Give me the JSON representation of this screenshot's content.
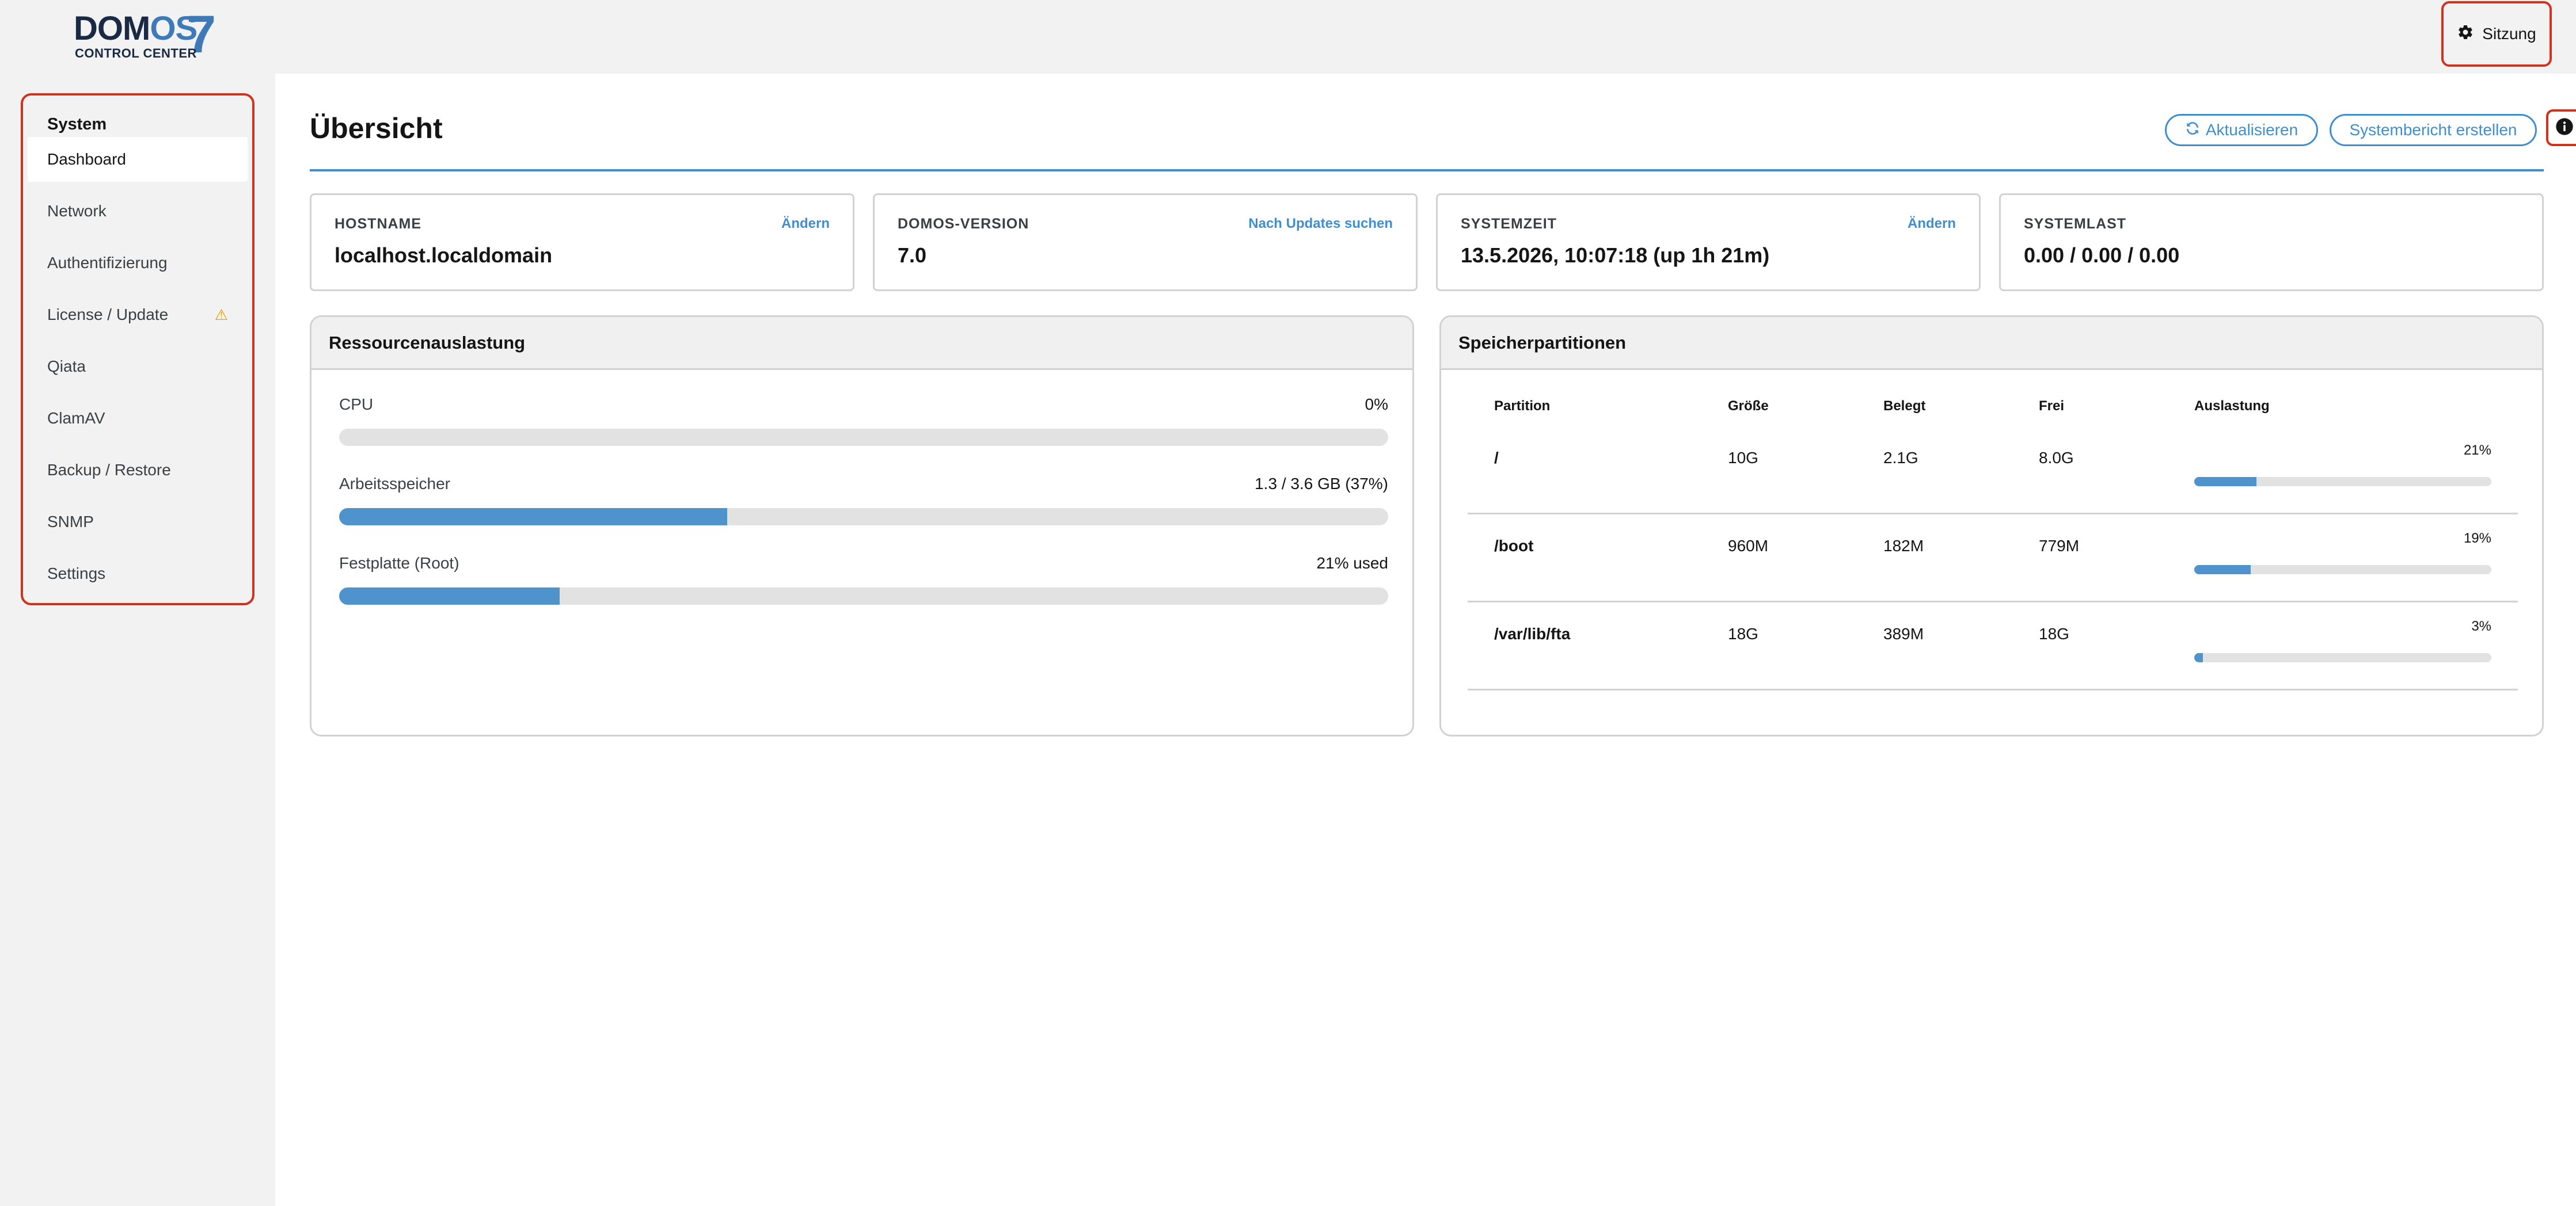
{
  "header": {
    "logo_main": "DOM",
    "logo_os": "OS",
    "logo_seven": "7",
    "logo_sub": "CONTROL CENTER",
    "session_label": "Sitzung"
  },
  "sidebar": {
    "heading": "System",
    "items": [
      {
        "label": "Dashboard",
        "active": true
      },
      {
        "label": "Network"
      },
      {
        "label": "Authentifizierung"
      },
      {
        "label": "License / Update",
        "warning": true
      },
      {
        "label": "Qiata"
      },
      {
        "label": "ClamAV"
      },
      {
        "label": "Backup / Restore"
      },
      {
        "label": "SNMP"
      },
      {
        "label": "Settings"
      }
    ]
  },
  "main": {
    "title": "Übersicht",
    "refresh_label": "Aktualisieren",
    "report_label": "Systembericht erstellen",
    "cards": [
      {
        "label": "HOSTNAME",
        "link": "Ändern",
        "value": "localhost.localdomain"
      },
      {
        "label": "DOMOS-VERSION",
        "link": "Nach Updates suchen",
        "value": "7.0"
      },
      {
        "label": "SYSTEMZEIT",
        "link": "Ändern",
        "value": "13.5.2026, 10:07:18 (up 1h 21m)"
      },
      {
        "label": "SYSTEMLAST",
        "link": "",
        "value": "0.00 / 0.00 / 0.00"
      }
    ],
    "resources": {
      "title": "Ressourcenauslastung",
      "items": [
        {
          "label": "CPU",
          "value": "0%",
          "percent": 0
        },
        {
          "label": "Arbeitsspeicher",
          "value": "1.3 / 3.6 GB (37%)",
          "percent": 37
        },
        {
          "label": "Festplatte (Root)",
          "value": "21% used",
          "percent": 21
        }
      ]
    },
    "partitions": {
      "title": "Speicherpartitionen",
      "headers": [
        "Partition",
        "Größe",
        "Belegt",
        "Frei",
        "Auslastung"
      ],
      "rows": [
        {
          "name": "/",
          "size": "10G",
          "used": "2.1G",
          "free": "8.0G",
          "usage": "21%",
          "percent": 21
        },
        {
          "name": "/boot",
          "size": "960M",
          "used": "182M",
          "free": "779M",
          "usage": "19%",
          "percent": 19
        },
        {
          "name": "/var/lib/fta",
          "size": "18G",
          "used": "389M",
          "free": "18G",
          "usage": "3%",
          "percent": 3
        }
      ]
    }
  },
  "colors": {
    "accent": "#3e8ed0",
    "highlight_border": "#d0321e",
    "warning": "#e0a100"
  }
}
